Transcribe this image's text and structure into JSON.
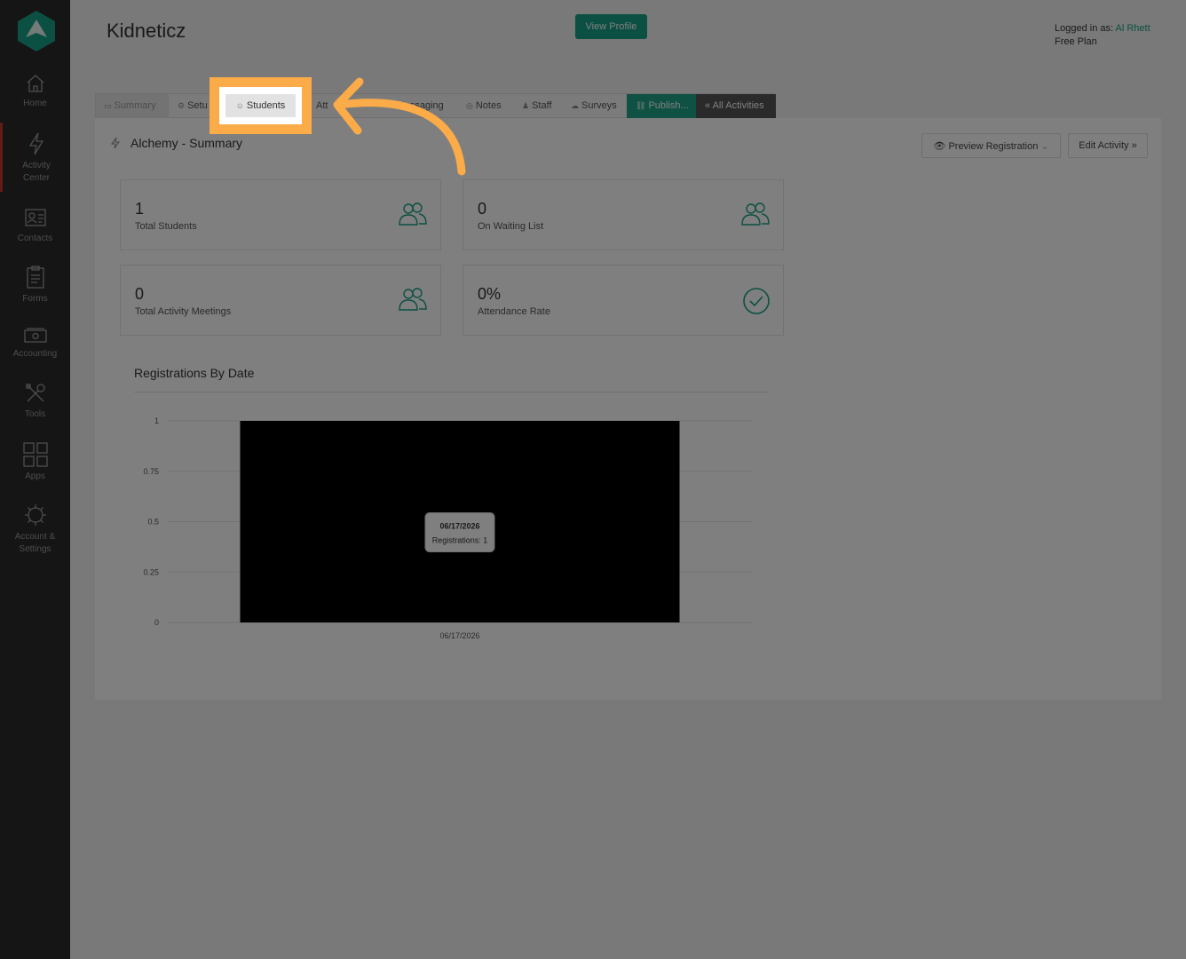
{
  "sidebar": {
    "items": [
      {
        "label": "Home",
        "icon": "home-icon"
      },
      {
        "label": "Activity Center",
        "icon": "bolt-icon"
      },
      {
        "label": "Contacts",
        "icon": "contacts-icon"
      },
      {
        "label": "Forms",
        "icon": "forms-icon"
      },
      {
        "label": "Accounting",
        "icon": "money-icon"
      },
      {
        "label": "Tools",
        "icon": "tools-icon"
      },
      {
        "label": "Apps",
        "icon": "apps-icon"
      },
      {
        "label": "Account & Settings",
        "icon": "gear-icon"
      }
    ]
  },
  "header": {
    "brand": "Kidneticz",
    "view_profile": "View Profile",
    "logged_in_prefix": "Logged in as:",
    "user": "Al Rhett",
    "plan": "Free Plan"
  },
  "tabs": [
    {
      "label": "Summary"
    },
    {
      "label": "Setu"
    },
    {
      "label": "Students"
    },
    {
      "label": "Att"
    },
    {
      "label": "Messaging"
    },
    {
      "label": "Notes"
    },
    {
      "label": "Staff"
    },
    {
      "label": "Surveys"
    },
    {
      "label": "Publish..."
    },
    {
      "label": "« All Activities"
    }
  ],
  "panel": {
    "title": "Alchemy - Summary",
    "preview_registration": "Preview Registration",
    "edit_activity": "Edit Activity »"
  },
  "stats": [
    {
      "value": "1",
      "label": "Total Students",
      "icon": "users-icon"
    },
    {
      "value": "0",
      "label": "On Waiting List",
      "icon": "users-icon"
    },
    {
      "value": "0",
      "label": "Total Activity Meetings",
      "icon": "users-icon"
    },
    {
      "value": "0%",
      "label": "Attendance Rate",
      "icon": "check-circle-icon"
    }
  ],
  "colors": {
    "accent": "#16a085",
    "sidebar": "#2b2b2b",
    "highlight": "#fbab48"
  },
  "chart_data": {
    "type": "bar",
    "title": "Registrations By Date",
    "categories": [
      "06/17/2026"
    ],
    "series": [
      {
        "name": "Registrations",
        "values": [
          1
        ]
      }
    ],
    "ylim": [
      0,
      1
    ],
    "yticks": [
      "1",
      "0.75",
      "0.5",
      "0.25",
      "0"
    ],
    "grid": true,
    "tooltip": {
      "title": "06/17/2026",
      "text": "Registrations: 1"
    }
  }
}
